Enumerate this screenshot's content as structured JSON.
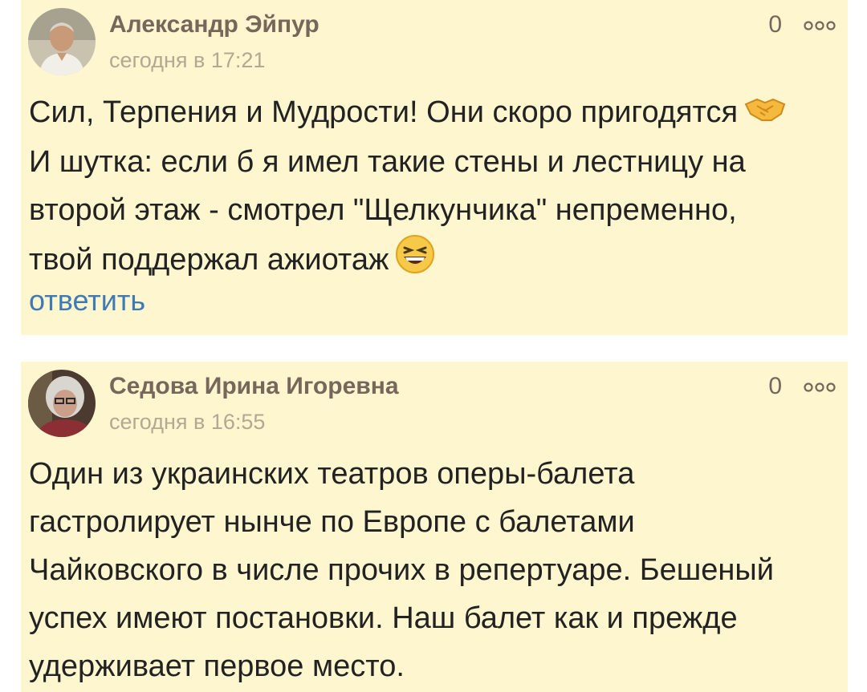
{
  "comments": [
    {
      "author": "Александр Эйпур",
      "time": "сегодня в 17:21",
      "count": "0",
      "lines": [
        "Сил, Терпения и Мудрости! Они скоро пригодятся",
        "И шутка: если б я имел такие стены и лестницу на",
        "второй этаж - смотрел \"Щелкунчика\" непременно,",
        "твой поддержал ажиотаж"
      ],
      "reply_label": "ответить",
      "icons": [
        "avatar-photo",
        "handshake-emoji",
        "laughing-emoji",
        "more-dots-icon"
      ]
    },
    {
      "author": "Седова Ирина Игоревна",
      "time": "сегодня в 16:55",
      "count": "0",
      "lines": [
        "Один из украинских театров оперы-балета",
        "гастролирует нынче по Европе с балетами",
        "Чайковского в числе прочих в репертуаре. Бешеный",
        "успех имеют постановки. Наш балет как и прежде",
        "удерживает первое место."
      ],
      "icons": [
        "avatar-photo",
        "more-dots-icon"
      ]
    }
  ],
  "colors": {
    "card_background": "#fdf6cf",
    "author": "#76675b",
    "timestamp": "#b3a891",
    "reply_link": "#3f7ab5",
    "text": "#222222"
  }
}
